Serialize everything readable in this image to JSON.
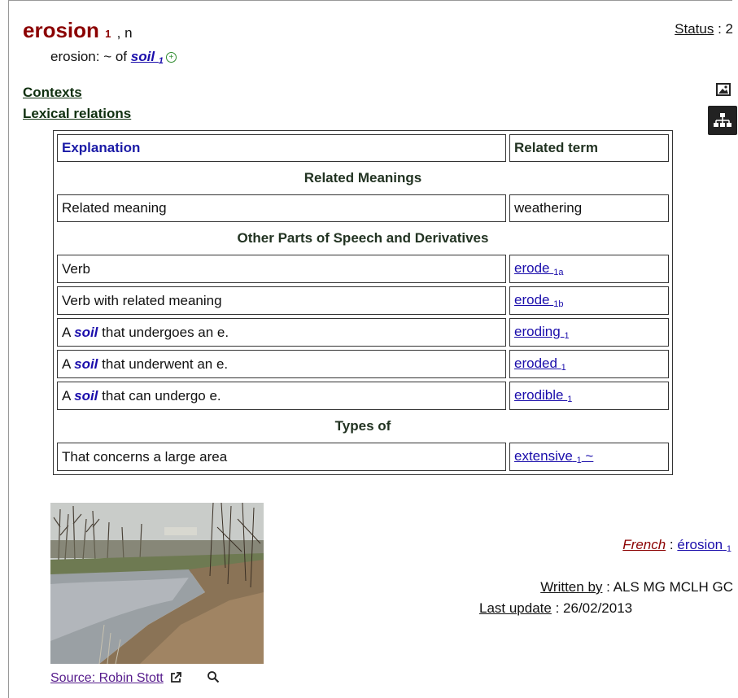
{
  "entry": {
    "term": "erosion",
    "sense": "1",
    "pos": ", n",
    "usage_prefix": "erosion: ~ of ",
    "usage_link": "soil",
    "usage_link_index": "1"
  },
  "status": {
    "label": "Status",
    "sep": " : ",
    "value": "2"
  },
  "sections": {
    "contexts": "Contexts",
    "lexical": "Lexical relations"
  },
  "icons": {
    "image": "image-icon",
    "hierarchy": "hierarchy-icon",
    "plus": "plus-circle-icon",
    "external": "external-link-icon",
    "zoom": "magnifier-icon"
  },
  "table": {
    "col_explanation": "Explanation",
    "col_related": "Related term",
    "groups": [
      {
        "heading": "Related Meanings"
      },
      {
        "heading": "Other Parts of Speech and Derivatives"
      },
      {
        "heading": "Types of"
      }
    ],
    "rows": [
      {
        "pre": "Related meaning",
        "soil": "",
        "post": "",
        "term": "weathering",
        "index": "",
        "link": false
      },
      {
        "pre": "Verb",
        "soil": "",
        "post": "",
        "term": "erode",
        "index": "1a",
        "link": true
      },
      {
        "pre": "Verb with related meaning",
        "soil": "",
        "post": "",
        "term": "erode",
        "index": "1b",
        "link": true
      },
      {
        "pre": "A ",
        "soil": "soil",
        "post": " that undergoes an e.",
        "term": "eroding",
        "index": "1",
        "link": true
      },
      {
        "pre": "A ",
        "soil": "soil",
        "post": " that underwent an e.",
        "term": "eroded",
        "index": "1",
        "link": true
      },
      {
        "pre": "A ",
        "soil": "soil",
        "post": " that can undergo e.",
        "term": "erodible",
        "index": "1",
        "link": true
      },
      {
        "pre": "That concerns a large area",
        "soil": "",
        "post": "",
        "term": "extensive",
        "index": "1",
        "suffix": " ~",
        "link": true
      }
    ]
  },
  "photo": {
    "source_label": "Source: Robin Stott"
  },
  "french": {
    "label": "French",
    "sep": " : ",
    "term": "érosion",
    "index": "1"
  },
  "written_by": {
    "label": "Written by",
    "sep": " : ",
    "value": "ALS MG MCLH GC"
  },
  "last_update": {
    "label": "Last update",
    "sep": " : ",
    "value": "26/02/2013"
  }
}
